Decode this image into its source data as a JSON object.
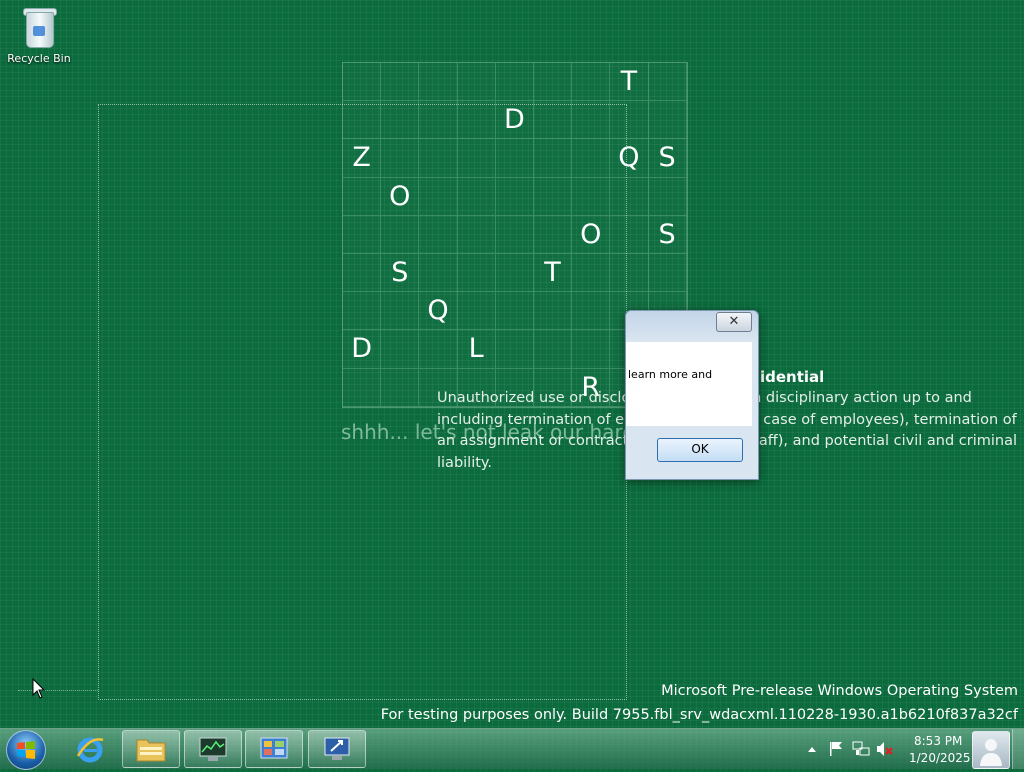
{
  "desktop": {
    "icons": [
      {
        "label": "Recycle Bin",
        "icon": "recycle-bin-icon"
      }
    ]
  },
  "screensaver": {
    "grid_rows": [
      [
        "",
        "",
        "",
        "",
        "",
        "",
        "",
        "T",
        ""
      ],
      [
        "",
        "",
        "",
        "",
        "D",
        "",
        "",
        "",
        ""
      ],
      [
        "Z",
        "",
        "",
        "",
        "",
        "",
        "",
        "Q",
        "S"
      ],
      [
        "",
        "O",
        "",
        "",
        "",
        "",
        "",
        "",
        ""
      ],
      [
        "",
        "",
        "",
        "",
        "",
        "",
        "O",
        "",
        "S"
      ],
      [
        "",
        "S",
        "",
        "",
        "",
        "T",
        "",
        "",
        ""
      ],
      [
        "",
        "",
        "Q",
        "",
        "",
        "",
        "",
        "",
        ""
      ],
      [
        "D",
        "",
        "",
        "L",
        "",
        "",
        "",
        "",
        ""
      ],
      [
        "",
        "",
        "",
        "",
        "",
        "",
        "R",
        "",
        ""
      ]
    ],
    "whisper": "shhh... let's not leak our hard work",
    "confidential_title": "idential",
    "confidential_body": "Unauthorized use or disclosure may result in disciplinary action up to and including termination of employment (in the case of employees), termination of an assignment or contract (for contingent staff), and potential civil and criminal liability."
  },
  "dialog": {
    "message": "learn more and",
    "ok_label": "OK",
    "close_symbol": "✕"
  },
  "watermark": {
    "line1": "Microsoft Pre-release Windows Operating System",
    "line2": "For testing purposes only. Build 7955.fbl_srv_wdacxml.110228-1930.a1b6210f837a32cf"
  },
  "taskbar": {
    "start_icon": "windows-logo-icon",
    "pinned": [
      {
        "name": "internet-explorer",
        "icon": "internet-explorer-icon",
        "active": false
      },
      {
        "name": "windows-explorer",
        "icon": "folder-icon",
        "active": true
      },
      {
        "name": "task-manager",
        "icon": "task-manager-icon",
        "active": true
      },
      {
        "name": "control-panel",
        "icon": "control-panel-icon",
        "active": true
      },
      {
        "name": "remote-desktop",
        "icon": "remote-desktop-icon",
        "active": true
      }
    ],
    "tray_icons": [
      "show-hidden-icons",
      "action-center-flag-icon",
      "network-icon",
      "volume-muted-icon"
    ],
    "clock": {
      "time": "8:53 PM",
      "date": "1/20/2025"
    }
  },
  "colors": {
    "desktop_background": "#0b6b3d",
    "accent_blue": "#2f6fb0"
  }
}
